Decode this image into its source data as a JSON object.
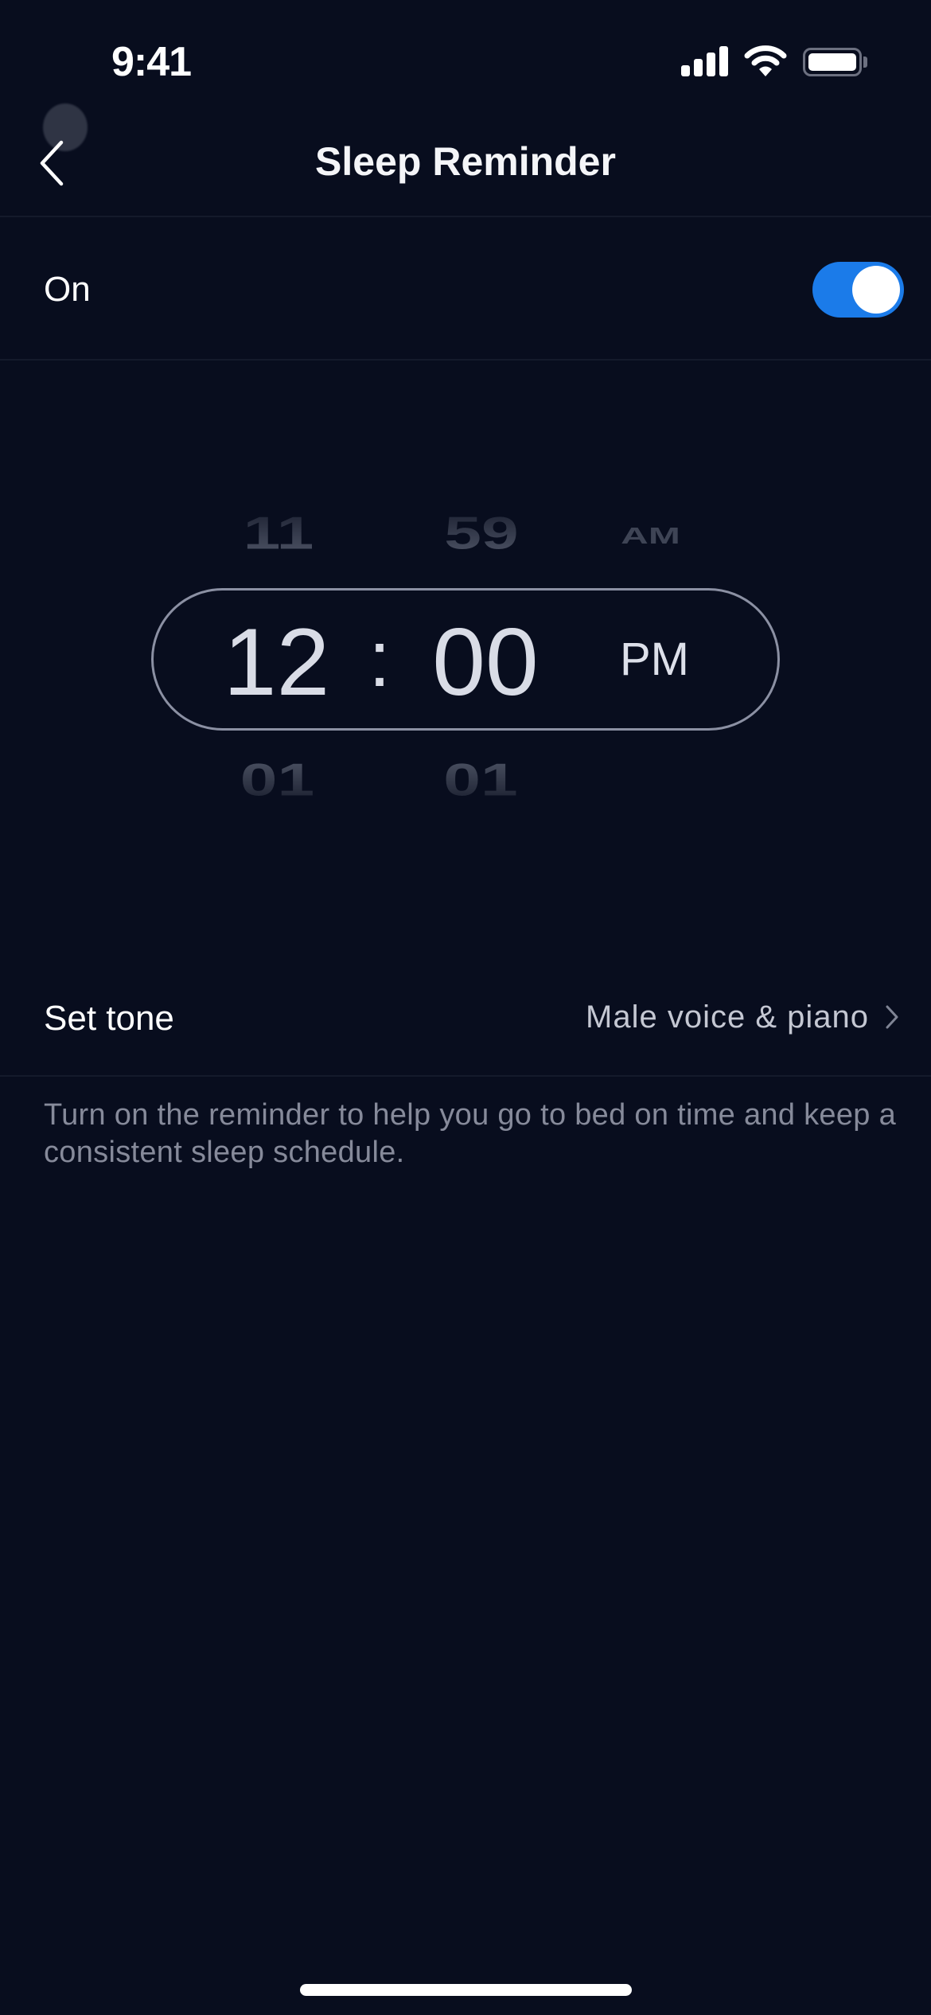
{
  "status_bar": {
    "time": "9:41",
    "icons": [
      "signal-icon",
      "wifi-icon",
      "battery-icon"
    ]
  },
  "nav": {
    "back_icon": "chevron-left-icon",
    "title": "Sleep Reminder"
  },
  "reminder_toggle": {
    "label": "On",
    "enabled": true,
    "accent_color": "#1b7be9"
  },
  "time_picker": {
    "hour": {
      "prev": "11",
      "selected": "12",
      "next": "01"
    },
    "separator": ":",
    "minute": {
      "prev": "59",
      "selected": "00",
      "next": "01"
    },
    "period": {
      "prev": "AM",
      "selected": "PM"
    }
  },
  "tone_row": {
    "label": "Set tone",
    "value": "Male voice & piano",
    "icon": "chevron-right-icon"
  },
  "description": "Turn on the reminder to help you go to bed on time and keep a consistent sleep schedule.",
  "colors": {
    "background": "#080d1e",
    "divider": "#141a2b",
    "picker_border": "#8b90a3",
    "secondary_text": "#868a9a"
  }
}
